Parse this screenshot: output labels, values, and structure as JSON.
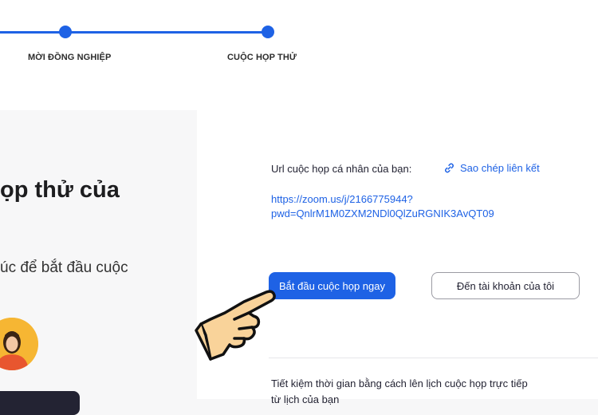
{
  "stepper": {
    "steps": [
      {
        "label": "MỜI ĐỒNG NGHIỆP",
        "state": "complete"
      },
      {
        "label": "CUỘC HỌP THỬ",
        "state": "current"
      }
    ],
    "accent": "#1e62e5"
  },
  "left": {
    "title": "ọp thử của",
    "subtitle": "úc để bắt đầu cuộc",
    "avatar_icon": "person-avatar-icon"
  },
  "meeting": {
    "url_label": "Url cuộc họp cá nhân của bạn:",
    "copy_link_label": "Sao chép liên kết",
    "copy_icon": "link-icon",
    "url_line_1": "https://zoom.us/j/2166775944?",
    "url_line_2": "pwd=QnlrM1M0ZXM2NDl0QlZuRGNIK3AvQT09",
    "start_button": "Bắt đầu cuộc họp ngay",
    "account_button": "Đến tài khoản của tôi",
    "footer_line_1": "Tiết kiệm thời gian bằng cách lên lịch cuộc họp trực tiếp",
    "footer_line_2": "từ lịch của bạn"
  },
  "overlay": {
    "pointer_icon": "pointing-hand-icon"
  }
}
